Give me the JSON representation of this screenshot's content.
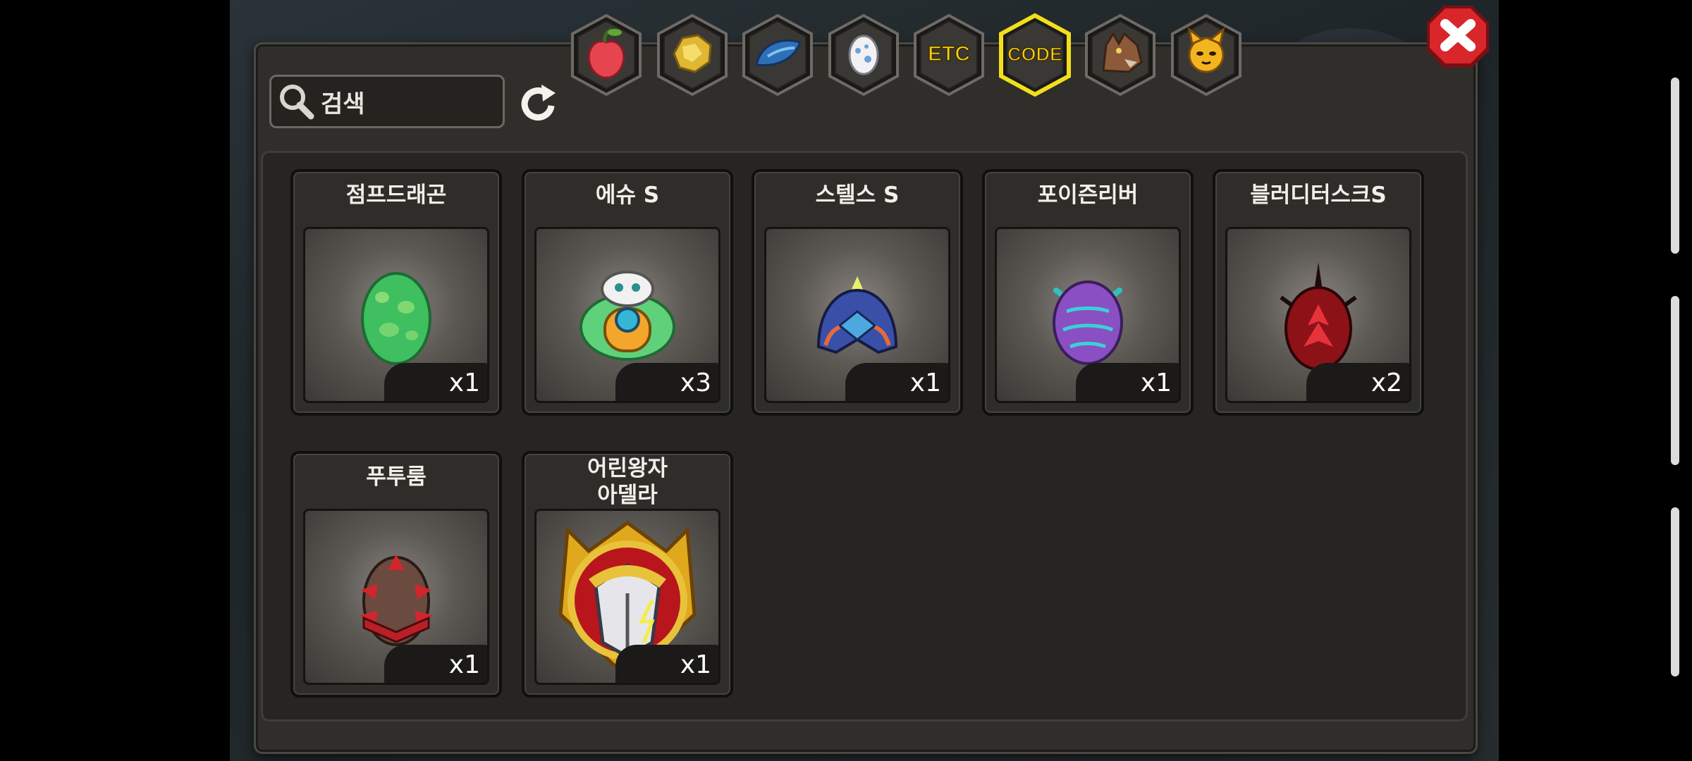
{
  "search": {
    "placeholder": "검색"
  },
  "tabs": [
    {
      "icon": "fruit-icon",
      "active": false
    },
    {
      "icon": "gold-nugget-icon",
      "active": false
    },
    {
      "icon": "dragon-scale-icon",
      "active": false
    },
    {
      "icon": "egg-icon",
      "active": false
    },
    {
      "label": "ETC",
      "icon": "etc-icon",
      "active": false
    },
    {
      "label": "CODE",
      "icon": "code-icon",
      "active": true
    },
    {
      "icon": "wolf-icon",
      "active": false
    },
    {
      "icon": "cat-face-icon",
      "active": false
    }
  ],
  "items": [
    {
      "name": "점프드래곤",
      "qty": "x1",
      "icon": "green-egg-icon"
    },
    {
      "name": "에슈 S",
      "qty": "x3",
      "icon": "robot-creature-icon"
    },
    {
      "name": "스텔스 S",
      "qty": "x1",
      "icon": "stealth-dragon-icon"
    },
    {
      "name": "포이즌리버",
      "qty": "x1",
      "icon": "purple-egg-icon"
    },
    {
      "name": "블러디터스크S",
      "qty": "x2",
      "icon": "red-egg-icon"
    },
    {
      "name": "푸투룸",
      "qty": "x1",
      "icon": "spiked-egg-icon"
    },
    {
      "name": "어린왕자\n아델라",
      "name_line1": "어린왕자",
      "name_line2": "아델라",
      "qty": "x1",
      "icon": "knight-emblem-icon"
    }
  ],
  "colors": {
    "accent_active_tab": "#f2df1a",
    "close_red": "#d8262b"
  }
}
